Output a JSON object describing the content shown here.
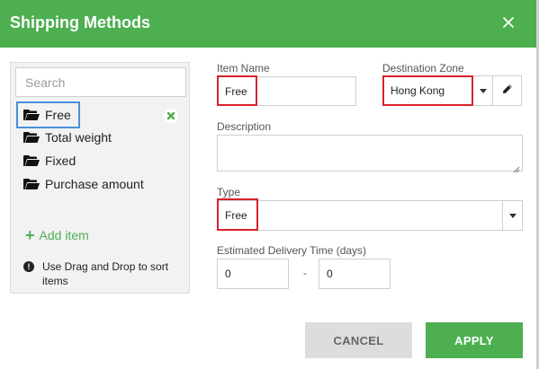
{
  "dialog": {
    "title": "Shipping Methods",
    "close_icon": "close-icon"
  },
  "colors": {
    "accent": "#4daf50",
    "highlight": "#d6232a",
    "selection": "#4a90d9"
  },
  "sidebar": {
    "search_placeholder": "Search",
    "items": [
      {
        "label": "Free",
        "icon": "folder-open-icon",
        "selected": true
      },
      {
        "label": "Total weight",
        "icon": "folder-open-icon"
      },
      {
        "label": "Fixed",
        "icon": "folder-open-icon"
      },
      {
        "label": "Purchase amount",
        "icon": "folder-open-icon"
      }
    ],
    "add_label": "Add item",
    "hint": "Use Drag and Drop to sort items"
  },
  "form": {
    "item_name_label": "Item Name",
    "item_name_value": "Free",
    "destination_label": "Destination Zone",
    "destination_value": "Hong Kong",
    "description_label": "Description",
    "description_value": "",
    "type_label": "Type",
    "type_value": "Free",
    "delivery_label": "Estimated Delivery Time (days)",
    "delivery_from": "0",
    "delivery_separator": "-",
    "delivery_to": "0"
  },
  "actions": {
    "cancel_label": "CANCEL",
    "apply_label": "APPLY"
  }
}
